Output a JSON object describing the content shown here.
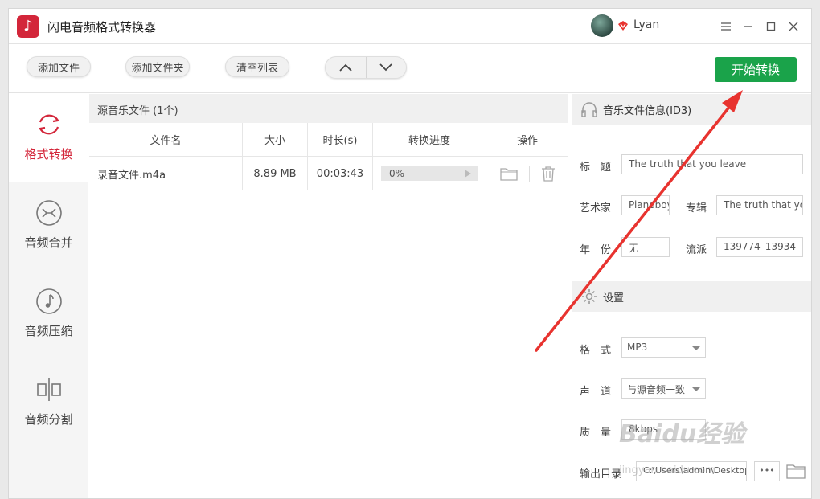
{
  "app": {
    "title": "闪电音频格式转换器",
    "username": "Lyan"
  },
  "toolbar": {
    "add_file": "添加文件",
    "add_folder": "添加文件夹",
    "clear_list": "清空列表",
    "start": "开始转换"
  },
  "sidebar": {
    "items": [
      {
        "label": "格式转换",
        "icon": "refresh-icon",
        "active": true
      },
      {
        "label": "音频合并",
        "icon": "merge-icon",
        "active": false
      },
      {
        "label": "音频压缩",
        "icon": "music-note-icon",
        "active": false
      },
      {
        "label": "音频分割",
        "icon": "split-icon",
        "active": false
      }
    ]
  },
  "filelist": {
    "header": "源音乐文件 (1个)",
    "columns": [
      "文件名",
      "大小",
      "时长(s)",
      "转换进度",
      "操作"
    ],
    "rows": [
      {
        "name": "录音文件.m4a",
        "size": "8.89 MB",
        "duration": "00:03:43",
        "progress": "0%"
      }
    ]
  },
  "info": {
    "header": "音乐文件信息(ID3)",
    "title_label": "标　题",
    "title_value": "The truth that you leave",
    "artist_label": "艺术家",
    "artist_value": "Pianoboy",
    "album_label": "专辑",
    "album_value": "The truth that you leave",
    "year_label": "年　份",
    "year_value": "无",
    "genre_label": "流派",
    "genre_value": "139774_13934"
  },
  "settings": {
    "header": "设置",
    "format_label": "格　式",
    "format_value": "MP3",
    "channel_label": "声　道",
    "channel_value": "与源音频一致",
    "quality_label": "质　量",
    "quality_value": "8kbps",
    "output_label": "输出目录",
    "output_value": "C:\\Users\\admin\\Desktop",
    "more_label": "•••"
  },
  "watermark": {
    "main": "Baidu经验",
    "sub": "jingyan.baidu.com"
  },
  "colors": {
    "accent_red": "#d3263a",
    "start_green": "#1aa34a",
    "annotation_red": "#e8332f"
  }
}
